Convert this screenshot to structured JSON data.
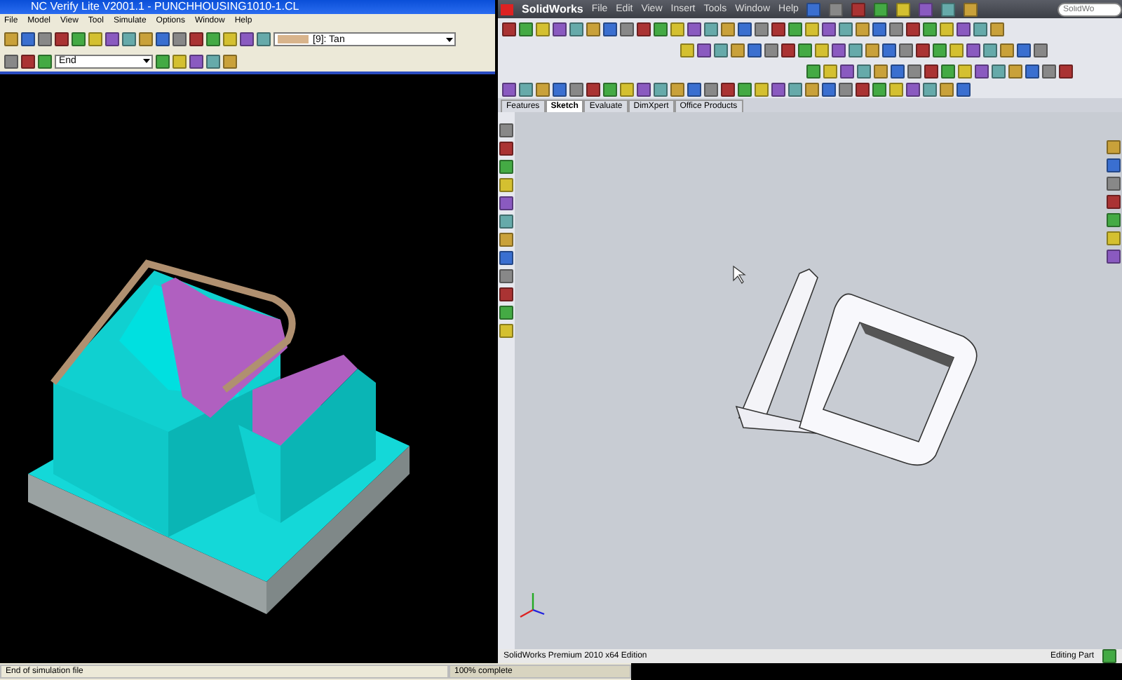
{
  "verify_window": {
    "title": "NC Verify Lite V2001.1 - PUNCHHOUSING1010-1.CL",
    "menu": [
      "File",
      "Model",
      "View",
      "Tool",
      "Simulate",
      "Options",
      "Window",
      "Help"
    ],
    "color_dropdown": {
      "value": "[9]: Tan"
    },
    "stop_dropdown": {
      "value": "End"
    },
    "status_bar": {
      "message": "End of simulation file",
      "progress": {
        "text": "100% complete",
        "level": 1
      }
    }
  },
  "solidworks_window": {
    "app_name": "SolidWorks",
    "menu": [
      "File",
      "Edit",
      "View",
      "Insert",
      "Tools",
      "Window",
      "Help"
    ],
    "search": {
      "placeholder": "SolidWo"
    },
    "tabs": [
      {
        "label": "Features",
        "selected": false
      },
      {
        "label": "Sketch",
        "selected": true
      },
      {
        "label": "Evaluate",
        "selected": false
      },
      {
        "label": "DimXpert",
        "selected": false
      },
      {
        "label": "Office Products",
        "selected": false
      }
    ],
    "status_bar": {
      "edition": "SolidWorks Premium 2010 x64 Edition",
      "mode": "Editing Part"
    }
  }
}
